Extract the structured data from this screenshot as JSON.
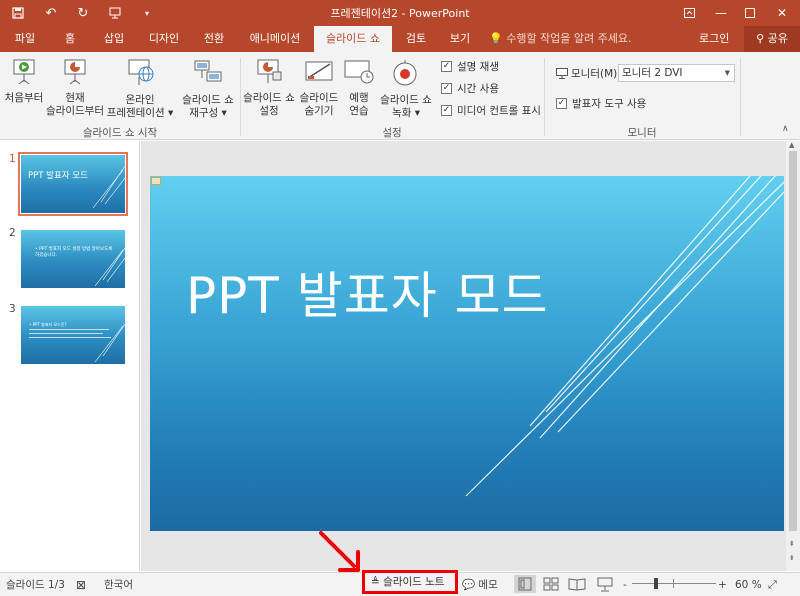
{
  "app": {
    "title": "프레젠테이션2 - PowerPoint",
    "accent": "#b7472a"
  },
  "quick_access": [
    {
      "name": "save-icon",
      "glyph": "🖫"
    },
    {
      "name": "undo-icon",
      "glyph": "↶"
    },
    {
      "name": "redo-icon",
      "glyph": "↻"
    },
    {
      "name": "present-icon",
      "glyph": "⊡"
    },
    {
      "name": "customize-icon",
      "glyph": "▾"
    }
  ],
  "window_controls": [
    {
      "name": "ribbon-display-icon",
      "glyph": "⊞"
    },
    {
      "name": "minimize-icon",
      "glyph": "—"
    },
    {
      "name": "maximize-icon",
      "glyph": "☐"
    },
    {
      "name": "close-icon",
      "glyph": "✕"
    }
  ],
  "tabs": [
    {
      "label": "파일",
      "active": false
    },
    {
      "label": "홈",
      "active": false
    },
    {
      "label": "삽입",
      "active": false
    },
    {
      "label": "디자인",
      "active": false
    },
    {
      "label": "전환",
      "active": false
    },
    {
      "label": "애니메이션",
      "active": false
    },
    {
      "label": "슬라이드 쇼",
      "active": true
    },
    {
      "label": "검토",
      "active": false
    },
    {
      "label": "보기",
      "active": false
    }
  ],
  "tellme": "수행할 작업을 알려 주세요.",
  "login": "로그인",
  "share": "공유",
  "ribbon": {
    "start_group": {
      "label": "슬라이드 쇼 시작",
      "from_beginning": "처음부터",
      "from_current_line1": "현재",
      "from_current_line2": "슬라이드부터",
      "online_line1": "온라인",
      "online_line2": "프레젠테이션 ▾",
      "custom_line1": "슬라이드 쇼",
      "custom_line2": "재구성 ▾"
    },
    "setup_group": {
      "label": "설정",
      "setup_line1": "슬라이드 쇼",
      "setup_line2": "설정",
      "hide_line1": "슬라이드",
      "hide_line2": "숨기기",
      "rehearse_line1": "예행",
      "rehearse_line2": "연습",
      "record_line1": "슬라이드 쇼",
      "record_line2": "녹화 ▾",
      "checks": [
        {
          "label": "설명 재생",
          "checked": true
        },
        {
          "label": "시간 사용",
          "checked": true
        },
        {
          "label": "미디어 컨트롤 표시",
          "checked": true
        }
      ]
    },
    "monitor_group": {
      "label": "모니터",
      "monitor_label": "모니터(M):",
      "monitor_value": "모니터 2 DVI",
      "presenter_view": "발표자 도구 사용",
      "presenter_checked": true
    }
  },
  "thumbnails": [
    {
      "num": "1",
      "text": "PPT 발표자 모드",
      "selected": true
    },
    {
      "num": "2",
      "text": "• PPT 발표자 모드 설정 방법 알아보도록 하겠습니다.",
      "selected": false
    },
    {
      "num": "3",
      "text": "• PPT 발표자 모드란?",
      "selected": false
    }
  ],
  "slide": {
    "title": "PPT 발표자 모드"
  },
  "status": {
    "slide_info": "슬라이드 1/3",
    "language": "한국어",
    "notes": "슬라이드 노트",
    "comments": "메모",
    "zoom_minus": "-",
    "zoom_plus": "+",
    "zoom": "60 %",
    "zoom_level_percent": 60
  }
}
